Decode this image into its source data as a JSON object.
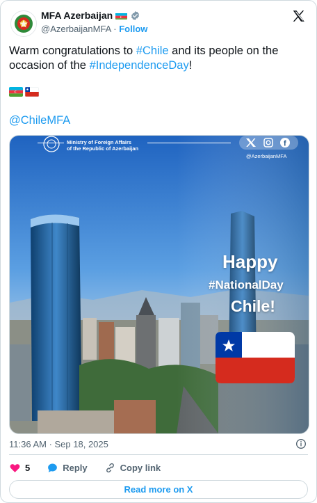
{
  "header": {
    "display_name": "MFA Azerbaijan",
    "handle": "@AzerbaijanMFA",
    "separator": "·",
    "follow_label": "Follow"
  },
  "tweet": {
    "text_part1": "Warm congratulations to ",
    "hashtag1": "#Chile",
    "text_part2": " and its people on the occasion of the ",
    "hashtag2": "#IndependenceDay",
    "text_part3": "!",
    "mention": "@ChileMFA"
  },
  "media": {
    "ministry_line1": "Ministry of Foreign Affairs",
    "ministry_line2": "of the Republic of Azerbaijan",
    "social_handle": "@AzerbaijanMFA",
    "headline1": "Happy",
    "headline2": "#NationalDay",
    "headline3": "Chile!"
  },
  "meta": {
    "timestamp": "11:36 AM · Sep 18, 2025"
  },
  "actions": {
    "like_count": "5",
    "reply_label": "Reply",
    "copy_label": "Copy link"
  },
  "footer": {
    "read_more_label": "Read more on X"
  },
  "colors": {
    "accent": "#1d9bf0",
    "like": "#f91880",
    "chile_red": "#d52b1e",
    "chile_blue": "#0039a6"
  }
}
